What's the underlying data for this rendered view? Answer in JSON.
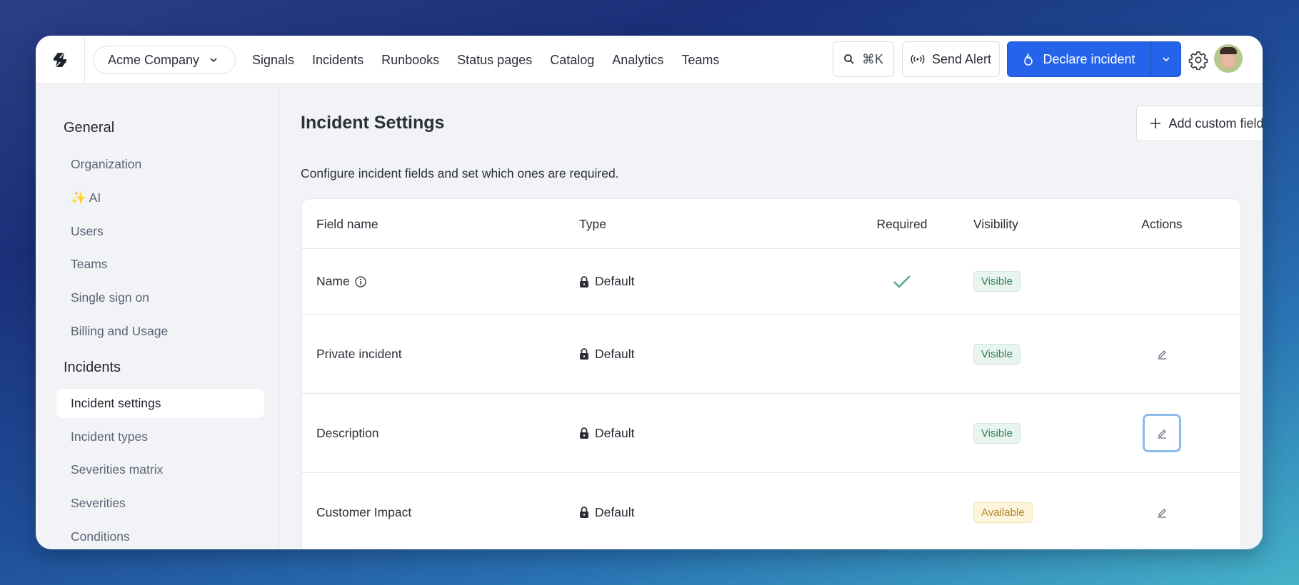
{
  "topbar": {
    "org_name": "Acme Company",
    "nav": [
      "Signals",
      "Incidents",
      "Runbooks",
      "Status pages",
      "Catalog",
      "Analytics",
      "Teams"
    ],
    "search_shortcut": "⌘K",
    "send_alert_label": "Send Alert",
    "declare_label": "Declare incident",
    "brand_color": "#2563eb"
  },
  "sidebar": {
    "sections": [
      {
        "title": "General",
        "items": [
          "Organization",
          "✨ AI",
          "Users",
          "Teams",
          "Single sign on",
          "Billing and Usage"
        ]
      },
      {
        "title": "Incidents",
        "items": [
          "Incident settings",
          "Incident types",
          "Severities matrix",
          "Severities",
          "Conditions"
        ]
      }
    ],
    "active_item": "Incident settings"
  },
  "main": {
    "title": "Incident Settings",
    "add_button_label": "Add custom field",
    "subtitle": "Configure incident fields and set which ones are required.",
    "table": {
      "columns": [
        "Field name",
        "Type",
        "Required",
        "Visibility",
        "Actions"
      ],
      "rows": [
        {
          "name": "Name",
          "has_info": true,
          "type": "Default",
          "required": true,
          "visibility": "Visible",
          "editable": false
        },
        {
          "name": "Private incident",
          "has_info": false,
          "type": "Default",
          "required": false,
          "visibility": "Visible",
          "editable": true
        },
        {
          "name": "Description",
          "has_info": false,
          "type": "Default",
          "required": false,
          "visibility": "Visible",
          "editable": true,
          "focused": true
        },
        {
          "name": "Customer Impact",
          "has_info": false,
          "type": "Default",
          "required": false,
          "visibility": "Available",
          "editable": true
        }
      ]
    }
  }
}
